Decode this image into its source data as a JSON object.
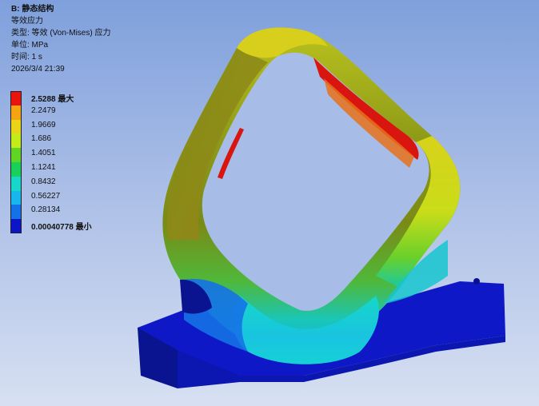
{
  "info": {
    "title": "B: 静态结构",
    "result": "等效应力",
    "type": "类型: 等效 (Von-Mises) 应力",
    "unit": "单位: MPa",
    "time": "时间: 1 s",
    "date": "2026/3/4 21:39"
  },
  "legend": {
    "entries": [
      {
        "label": "2.5288 最大",
        "color": "#e8150f"
      },
      {
        "label": "2.2479",
        "color": "#f5a310"
      },
      {
        "label": "1.9669",
        "color": "#e8d51a"
      },
      {
        "label": "1.686",
        "color": "#c4ec18"
      },
      {
        "label": "1.4051",
        "color": "#5fd626"
      },
      {
        "label": "1.1241",
        "color": "#18d05a"
      },
      {
        "label": "0.8432",
        "color": "#16d7c8"
      },
      {
        "label": "0.56227",
        "color": "#19b6ee"
      },
      {
        "label": "0.28134",
        "color": "#1572e6"
      },
      {
        "label": "0.00040778 最小",
        "color": "#0c15c8"
      }
    ]
  }
}
